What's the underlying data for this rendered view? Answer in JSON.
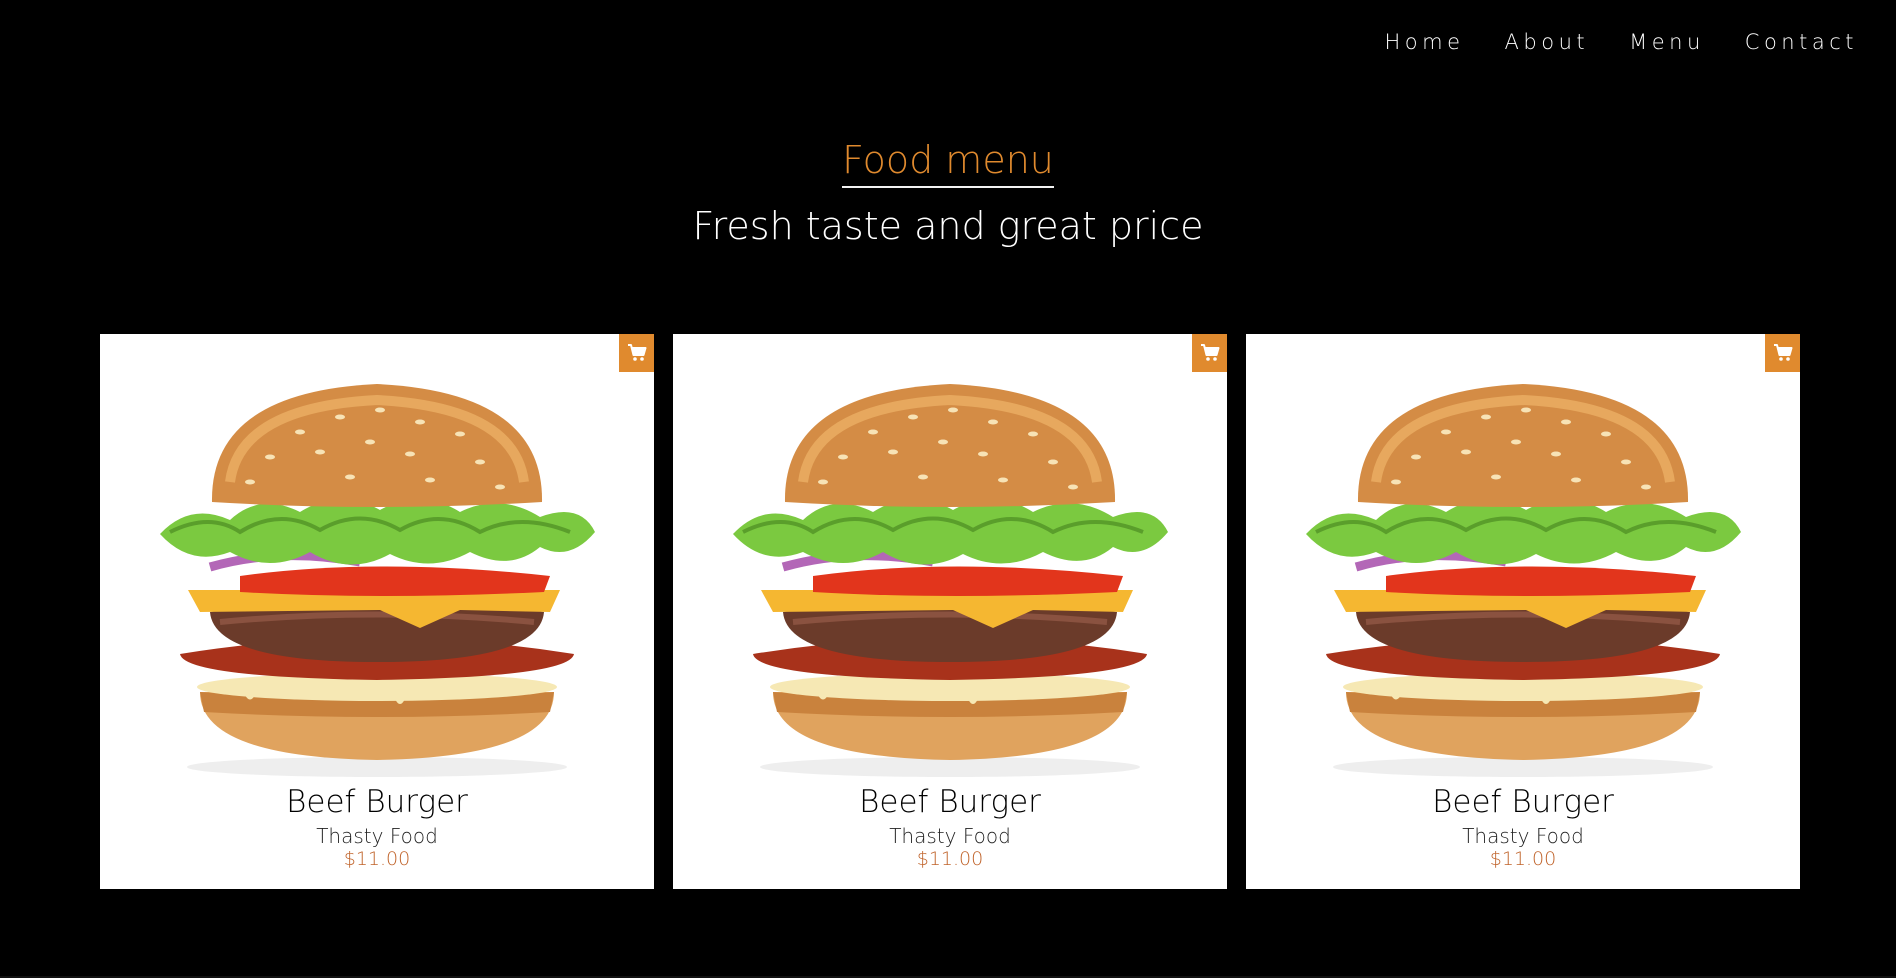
{
  "nav": {
    "items": [
      "Home",
      "About",
      "Menu",
      "Contact"
    ]
  },
  "section": {
    "title": "Food menu",
    "subtitle": "Fresh taste and great price"
  },
  "cards": [
    {
      "name": "Beef Burger",
      "desc": "Thasty Food",
      "price": "$11.00",
      "cart_icon": "cart-icon"
    },
    {
      "name": "Beef Burger",
      "desc": "Thasty Food",
      "price": "$11.00",
      "cart_icon": "cart-icon"
    },
    {
      "name": "Beef Burger",
      "desc": "Thasty Food",
      "price": "$11.00",
      "cart_icon": "cart-icon"
    }
  ],
  "colors": {
    "accent": "#e08a2e",
    "price": "#c0632a",
    "background": "#000000",
    "card": "#ffffff"
  }
}
